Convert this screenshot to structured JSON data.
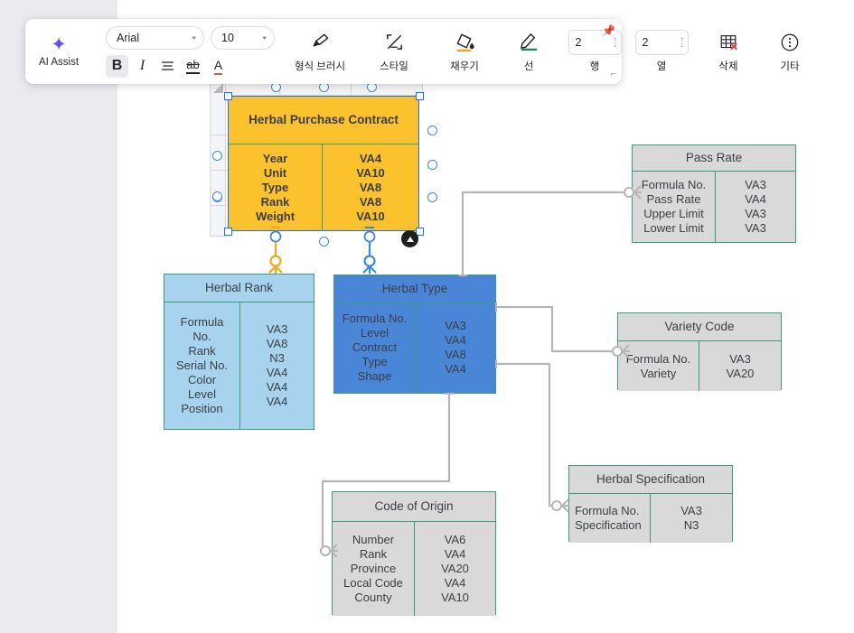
{
  "toolbar": {
    "ai_assist_label": "AI Assist",
    "ai_icon": "sparkle-icon",
    "font_family": "Arial",
    "font_size": "10",
    "bold_label": "B",
    "italic_label": "I",
    "align_icon": "align-left-icon",
    "strikethrough_label": "ab",
    "font_color_label": "A",
    "format_brush_label": "형식 브러시",
    "format_brush_icon": "paint-brush-icon",
    "style_label": "스타일",
    "style_icon": "style-icon",
    "fill_label": "채우기",
    "fill_icon": "fill-bucket-icon",
    "line_label": "선",
    "line_icon": "pen-line-icon",
    "row_value": "2",
    "row_label": "행",
    "column_value": "2",
    "column_label": "열",
    "delete_label": "삭제",
    "delete_icon": "table-delete-icon",
    "more_label": "기타",
    "more_icon": "more-vertical-icon",
    "pin_icon": "pin-icon",
    "resize_icon": "resize-corner-icon"
  },
  "diagram": {
    "entities": [
      {
        "id": "herbal-purchase-contract",
        "title": "Herbal Purchase Contract",
        "fields": [
          "Year",
          "Unit",
          "Type",
          "Rank",
          "Weight"
        ],
        "types": [
          "VA4",
          "VA10",
          "VA8",
          "VA8",
          "VA10"
        ],
        "fill": "#fcc22e",
        "selected": true
      },
      {
        "id": "pass-rate",
        "title": "Pass Rate",
        "fields": [
          "Formula No.",
          "Pass Rate",
          "Upper Limit",
          "Lower Limit"
        ],
        "types": [
          "VA3",
          "VA4",
          "VA3",
          "VA3"
        ],
        "fill": "#d9d9d9",
        "selected": false
      },
      {
        "id": "herbal-rank",
        "title": "Herbal Rank",
        "fields": [
          "Formula No.",
          "Rank",
          "Serial No.",
          "Color",
          "Level",
          "Position"
        ],
        "types": [
          "VA3",
          "VA8",
          "N3",
          "VA4",
          "VA4",
          "VA4"
        ],
        "fill": "#a8d3ee",
        "selected": false
      },
      {
        "id": "herbal-type",
        "title": "Herbal Type",
        "fields": [
          "Formula No.",
          "Level",
          "Contract",
          "Type",
          "Shape"
        ],
        "types": [
          "VA3",
          "VA4",
          "VA8",
          "VA4"
        ],
        "fill": "#4a86d8",
        "selected": false
      },
      {
        "id": "variety-code",
        "title": "Variety Code",
        "fields": [
          "Formula No.",
          "Variety"
        ],
        "types": [
          "VA3",
          "VA20"
        ],
        "fill": "#d9d9d9",
        "selected": false
      },
      {
        "id": "herbal-specification",
        "title": "Herbal Specification",
        "fields": [
          "Formula No.",
          "Specification"
        ],
        "types": [
          "VA3",
          "N3"
        ],
        "fill": "#d9d9d9",
        "selected": false
      },
      {
        "id": "code-of-origin",
        "title": "Code of Origin",
        "fields": [
          "Number",
          "Rank",
          "Province",
          "Local Code",
          "County"
        ],
        "types": [
          "VA6",
          "VA4",
          "VA20",
          "VA4",
          "VA10"
        ],
        "fill": "#d9d9d9",
        "selected": false
      }
    ]
  }
}
